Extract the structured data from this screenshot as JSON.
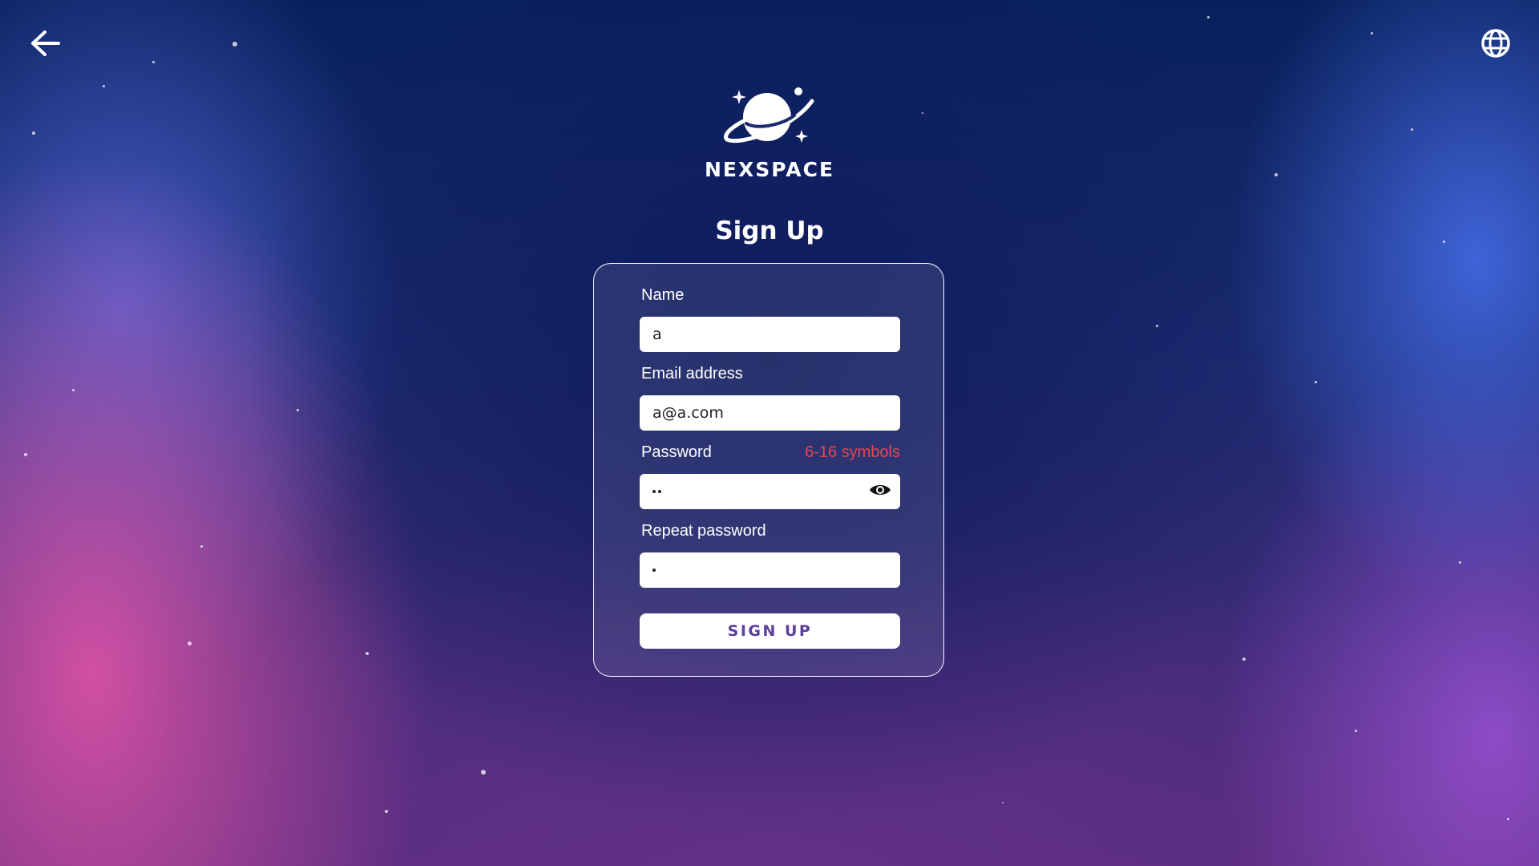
{
  "brand": {
    "name": "NEXSPACE"
  },
  "page": {
    "title": "Sign Up"
  },
  "form": {
    "name": {
      "label": "Name",
      "value": "a"
    },
    "email": {
      "label": "Email address",
      "value": "a@a.com"
    },
    "password": {
      "label": "Password",
      "hint": "6-16 symbols",
      "masked_length": 2,
      "hint_color": "#e8454f"
    },
    "repeat_password": {
      "label": "Repeat password",
      "masked_length": 1
    },
    "submit_label": "SIGN UP",
    "submit_color": "#5a3f9e"
  },
  "icons": {
    "back": "arrow-left-icon",
    "language": "globe-icon",
    "toggle_password": "eye-icon",
    "logo": "planet-icon"
  }
}
